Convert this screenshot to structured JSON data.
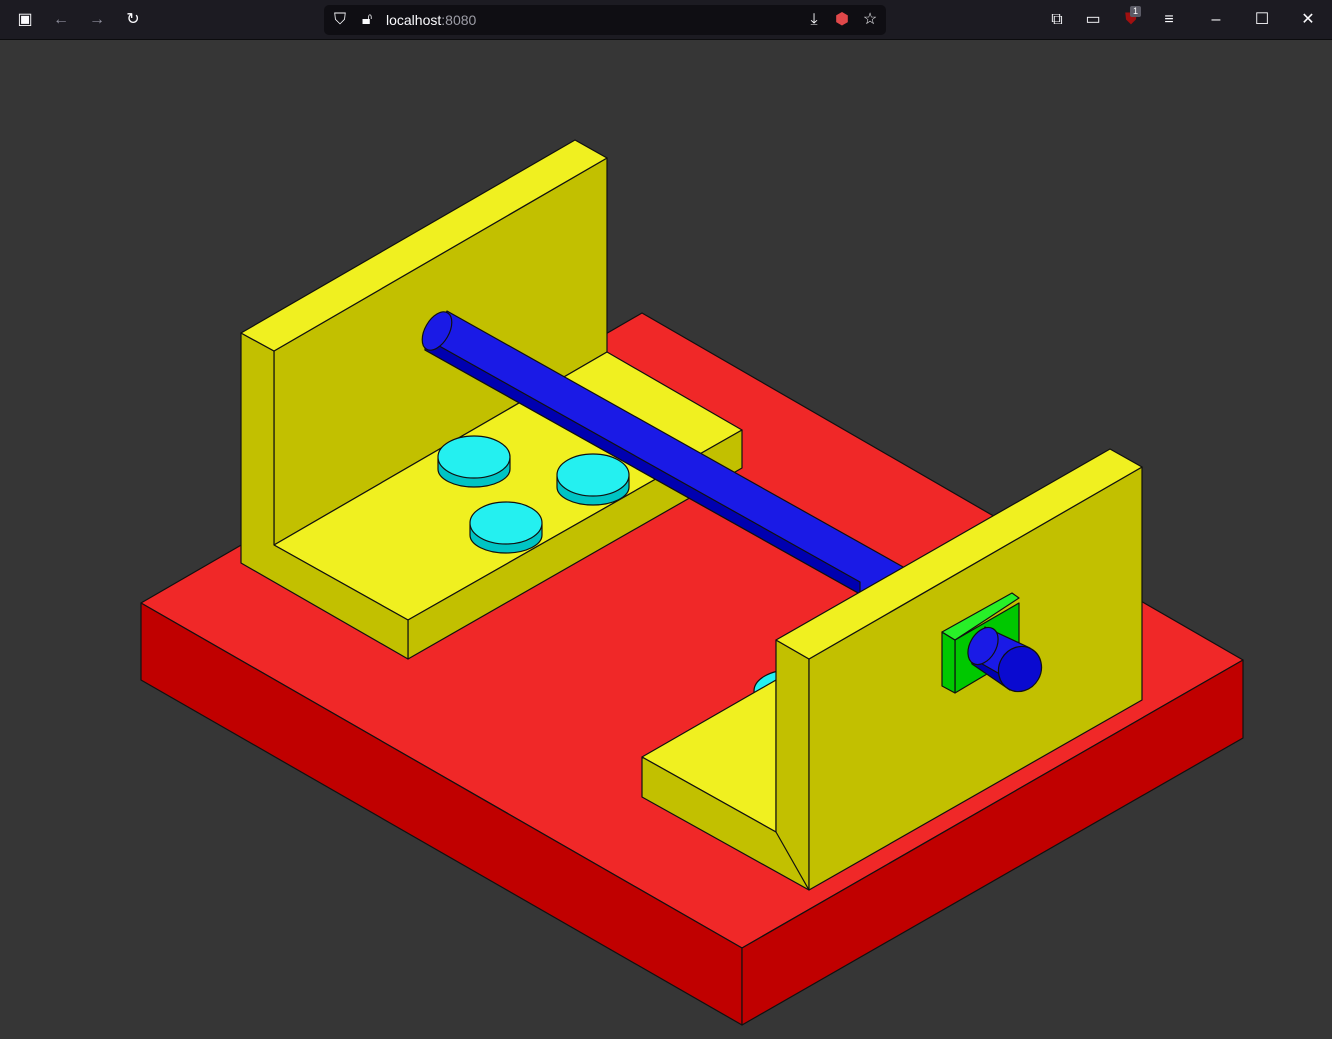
{
  "browser": {
    "url_host": "localhost",
    "url_port": ":8080",
    "extension_badge": "1",
    "icons": [
      "sidebar-icon",
      "back-icon",
      "forward-icon",
      "reload-icon",
      "shield-icon",
      "lock-warning-icon",
      "save-page-icon",
      "extension-hex-icon",
      "bookmark-star-icon",
      "extensions-icon",
      "tab-view-icon",
      "ublock-icon",
      "menu-icon",
      "minimize-icon",
      "maximize-icon",
      "close-icon"
    ]
  },
  "scene": {
    "colors": {
      "background": "#363636",
      "base_top": "#f02828",
      "base_side": "#c00000",
      "bracket_light": "#f0f020",
      "bracket_dark": "#c2c000",
      "rod": "#1a1ae6",
      "rod_dark": "#0000b0",
      "disc_top": "#24f0f0",
      "disc_side": "#00c4c4",
      "plate_light": "#28f028",
      "plate_dark": "#00c800"
    }
  }
}
